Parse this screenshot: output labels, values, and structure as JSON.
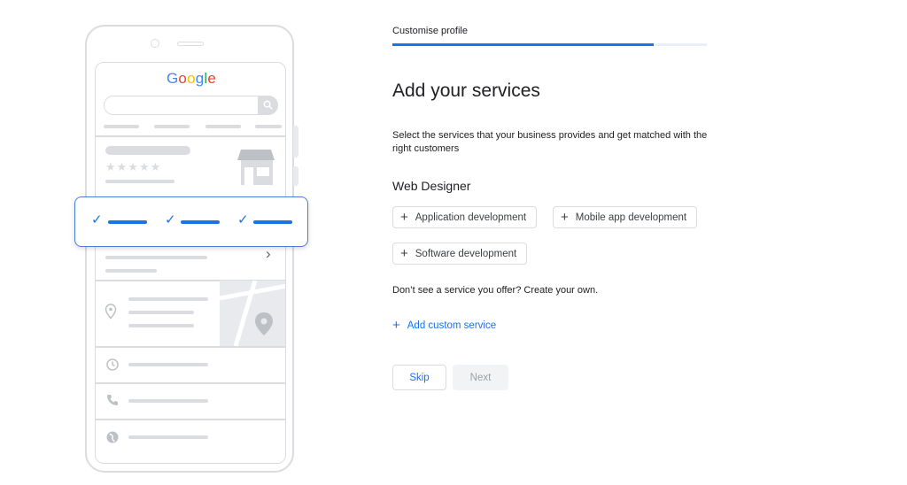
{
  "illustration": {
    "logo_letters": [
      {
        "char": "G",
        "color": "#4285f4"
      },
      {
        "char": "o",
        "color": "#ea4335"
      },
      {
        "char": "o",
        "color": "#fbbc05"
      },
      {
        "char": "g",
        "color": "#4285f4"
      },
      {
        "char": "l",
        "color": "#34a853"
      },
      {
        "char": "e",
        "color": "#ea4335"
      }
    ],
    "rating_stars": "★★★★★",
    "check_glyph": "✓",
    "chevron_glyph": "›",
    "icons": [
      "search-icon",
      "storefront-icon",
      "location-pin-icon",
      "clock-icon",
      "phone-icon",
      "globe-icon",
      "map-pin-icon"
    ]
  },
  "header": {
    "step_label": "Customise profile",
    "progress_fraction": 0.83
  },
  "main": {
    "title": "Add your services",
    "description": "Select the services that your business provides and get matched with the right customers",
    "category": "Web Designer",
    "plus_glyph": "+",
    "services": [
      {
        "label": "Application development"
      },
      {
        "label": "Mobile app development"
      },
      {
        "label": "Software development"
      }
    ],
    "create_own_text": "Don’t see a service you offer? Create your own.",
    "add_custom_label": "Add custom service"
  },
  "actions": {
    "skip_label": "Skip",
    "next_label": "Next",
    "next_disabled": true
  },
  "colors": {
    "accent": "#1a73e8",
    "border": "#dadce0",
    "placeholder_grey": "#dadce0"
  }
}
